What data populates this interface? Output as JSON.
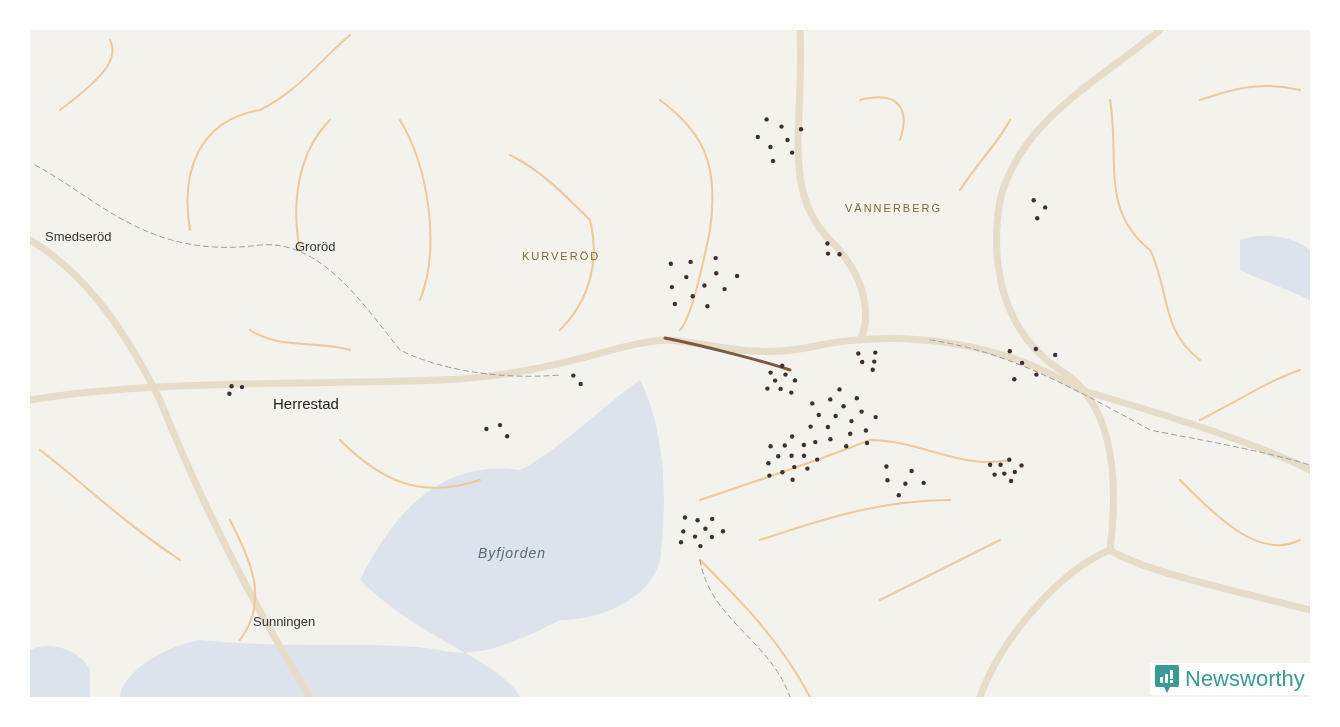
{
  "map": {
    "labels": [
      {
        "text": "Smedseröd",
        "kind": "place"
      },
      {
        "text": "Groröd",
        "kind": "place"
      },
      {
        "text": "KURVERÖD",
        "kind": "district"
      },
      {
        "text": "VÄNNERBERG",
        "kind": "district"
      },
      {
        "text": "Herrestad",
        "kind": "town"
      },
      {
        "text": "Byfjorden",
        "kind": "water"
      },
      {
        "text": "Sunningen",
        "kind": "place"
      }
    ]
  },
  "brand": {
    "name": "Newsworthy"
  }
}
